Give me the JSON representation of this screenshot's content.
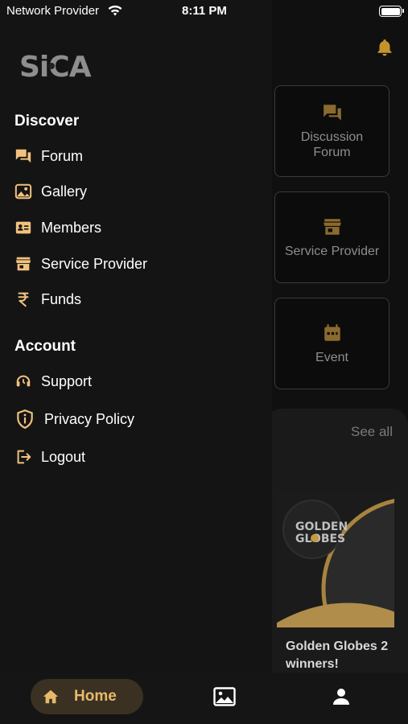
{
  "status_bar": {
    "carrier": "Network Provider",
    "time": "8:11 PM",
    "wifi_icon": "wifi-icon",
    "battery_icon": "battery-icon"
  },
  "brand": {
    "logo_text": "SiCA",
    "accent_color": "#e8b96a",
    "icon_color": "#f1c27d"
  },
  "drawer": {
    "discover_title": "Discover",
    "discover_items": [
      {
        "label": "Forum",
        "icon": "forum-icon"
      },
      {
        "label": "Gallery",
        "icon": "gallery-icon"
      },
      {
        "label": "Members",
        "icon": "members-card-icon"
      },
      {
        "label": "Service Provider",
        "icon": "storefront-icon"
      },
      {
        "label": "Funds",
        "icon": "rupee-icon"
      }
    ],
    "account_title": "Account",
    "account_items": [
      {
        "label": "Support",
        "icon": "support-headset-icon"
      },
      {
        "label": "Privacy Policy",
        "icon": "shield-info-icon"
      },
      {
        "label": "Logout",
        "icon": "logout-icon"
      }
    ]
  },
  "home": {
    "bell_icon": "bell-icon",
    "tiles": [
      {
        "label_line1": "Discussion",
        "label_line2": "Forum",
        "icon": "forum-icon"
      },
      {
        "label_line1": "Service Provider",
        "label_line2": "",
        "icon": "storefront-icon"
      },
      {
        "label_line1": "Event",
        "label_line2": "",
        "icon": "calendar-icon"
      }
    ],
    "see_all": "See all",
    "news_title_line1": "Golden Globes 2",
    "news_title_line2": "winners!",
    "news_image_text_line1": "GOLDEN",
    "news_image_text_line2": "GLOBES"
  },
  "bottom_nav": {
    "home_label": "Home",
    "home_icon": "home-icon",
    "gallery_icon": "image-icon",
    "profile_icon": "person-icon"
  }
}
